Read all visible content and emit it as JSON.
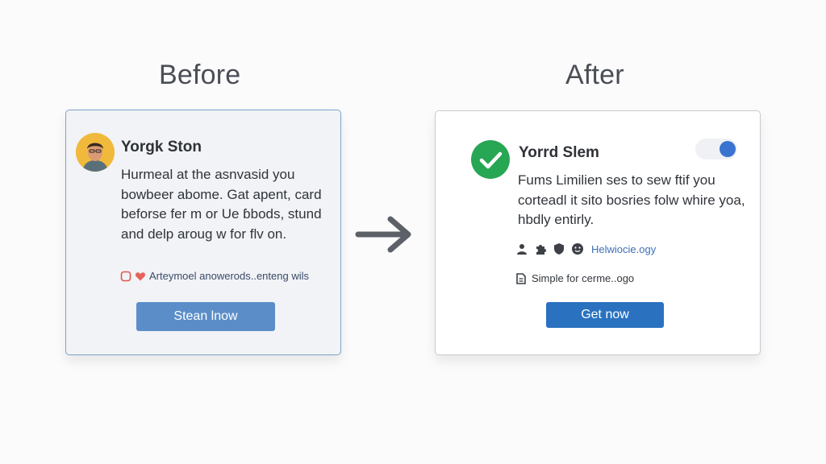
{
  "before": {
    "heading": "Before",
    "name": "Yorgk Ston",
    "body": "Hurmeal at the asnvasid you bowbeer abome. Gat apent, card beforse fer m or Ue ɓbods, stund and delp aroug w for flv on.",
    "reactions_text": "Arteymoel anowerods..enteng wils",
    "button_label": "Stean lnow",
    "colors": {
      "accent": "#5b8ec9",
      "border": "#7ea2cc"
    }
  },
  "after": {
    "heading": "After",
    "name": "Yorrd Slem",
    "body": "Fums Limilien ses to sew ftif you corteadl it sito bosries folw whire yoa, hbdly entirly.",
    "link_text": "Helwiocie.ogy",
    "note_text": "Simple for cerme..ogo",
    "button_label": "Get now",
    "colors": {
      "accent": "#2a72c0",
      "check": "#27a654",
      "toggle_knob": "#3b73d0"
    }
  },
  "icons": {
    "arrow": "right-arrow-icon",
    "check": "checkmark-icon",
    "meta": [
      "person-icon",
      "puzzle-icon",
      "shield-icon",
      "emoji-icon"
    ],
    "note": "document-icon",
    "reactions": [
      "square-icon",
      "heart-icon"
    ]
  }
}
